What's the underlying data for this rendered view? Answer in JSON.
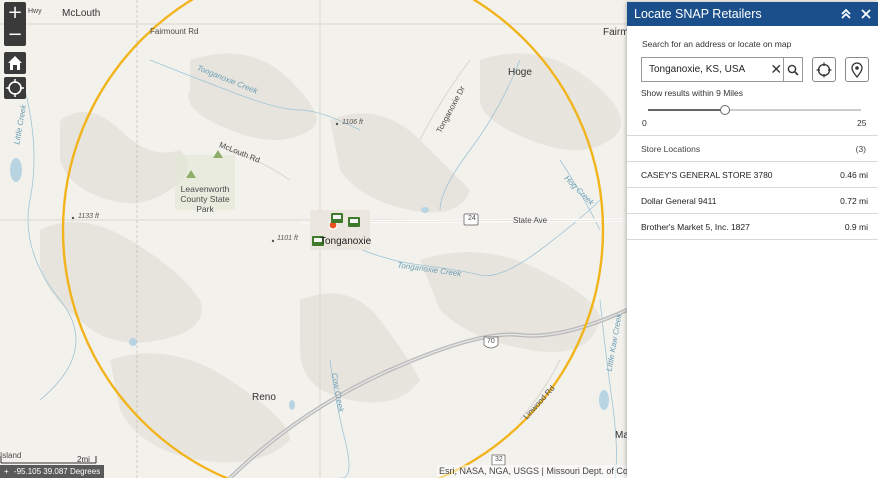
{
  "map": {
    "places": {
      "hwy": "Hwy",
      "mclouth": "McLouth",
      "fairmount_rd": "Fairmount Rd",
      "fairm": "Fairm",
      "hoge": "Hoge",
      "tonganoxie_creek_n": "Tonganoxie Creek",
      "tonganoxie_dr": "Tonganoxie Dr",
      "mclouth_rd": "McLouth Rd",
      "elev_1106": "1106 ft",
      "leavenworth_park": "Leavenworth County State Park",
      "hog_creek": "Hog Creek",
      "elev_1133": "1133 ft",
      "elev_1101": "1101 ft",
      "tonganoxie": "Tonganoxie",
      "state_ave": "State Ave",
      "tonganoxie_creek_s": "Tonganoxie Creek",
      "hwy_24": "24",
      "hwy_70": "70",
      "hwy_32": "32",
      "little_creek": "Little Creek",
      "cow_creek": "Cow Creek",
      "reno": "Reno",
      "linwood_rd": "Linwood Rd",
      "little_kaw_creek": "Little Kaw Creek",
      "ma": "Ma",
      "island": "Island"
    },
    "controls": {
      "zoom_in": "+",
      "zoom_out": "−"
    },
    "scale_label": "2mi",
    "coordinates": "-95.105 39.087 Degrees",
    "attribution": "Esri, NASA, NGA, USGS | Missouri Dept. of Co",
    "colors": {
      "buffer_ring": "#f2b41c",
      "search_marker": "#e8501e",
      "store_marker": "#3d7a2c"
    }
  },
  "panel": {
    "title": "Locate SNAP Retailers",
    "search_label": "Search for an address or locate on map",
    "search_value": "Tonganoxie, KS, USA",
    "radius_label": "Show results within 9 Miles",
    "slider_min": "0",
    "slider_max": "25",
    "slider_value": 9,
    "slider_value_max": 25,
    "list_header": "Store Locations",
    "list_count": "(3)",
    "stores": [
      {
        "name": "CASEY'S GENERAL STORE 3780",
        "distance": "0.46 mi"
      },
      {
        "name": "Dollar General 9411",
        "distance": "0.72 mi"
      },
      {
        "name": "Brother's Market 5, Inc. 1827",
        "distance": "0.9 mi"
      }
    ],
    "header_color": "#1a4f8b"
  }
}
